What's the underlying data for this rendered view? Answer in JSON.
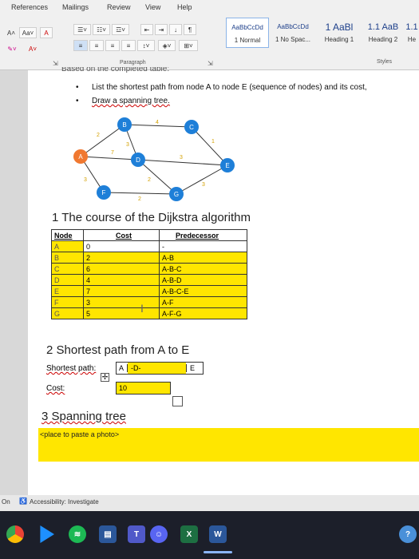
{
  "ribbon": {
    "tabs": [
      "References",
      "Mailings",
      "Review",
      "View",
      "Help"
    ],
    "paragraph_label": "Paragraph",
    "styles_label": "Styles",
    "styles": [
      {
        "preview": "AaBbCcDd",
        "name": "1 Normal"
      },
      {
        "preview": "AaBbCcDd",
        "name": "1 No Spac..."
      },
      {
        "preview": "1 AaBl",
        "name": "Heading 1"
      },
      {
        "preview": "1.1 AaB",
        "name": "Heading 2"
      },
      {
        "preview": "1.1",
        "name": "He"
      }
    ]
  },
  "doc": {
    "top_cut_text": "Based on the completed table:",
    "bullets": [
      "List the shortest path from node A to node E (sequence of nodes) and its cost,",
      "Draw a spanning tree."
    ],
    "section1": "1  The course of the Dijkstra algorithm",
    "table": {
      "headers": [
        "Node",
        "Cost",
        "Predecessor"
      ],
      "rows": [
        [
          "A",
          "0",
          "-"
        ],
        [
          "B",
          "2",
          "A-B"
        ],
        [
          "C",
          "6",
          "A-B-C"
        ],
        [
          "D",
          "4",
          "A-B-D"
        ],
        [
          "E",
          "7",
          "A-B-C-E"
        ],
        [
          "F",
          "3",
          "A-F"
        ],
        [
          "G",
          "5",
          "A-F-G"
        ]
      ]
    },
    "section2": "2  Shortest path from A to E",
    "path_label": "Shortest path:",
    "path_start": "A",
    "path_mid": "-D-",
    "path_end": "E",
    "cost_label": "Cost:",
    "cost_value": "10",
    "section3": "3  Spanning tree",
    "placeholder": "<place to paste a photo>"
  },
  "graph": {
    "nodes": [
      "A",
      "B",
      "C",
      "D",
      "E",
      "F",
      "G"
    ],
    "edge_weights": [
      "2",
      "4",
      "1",
      "7",
      "3",
      "3",
      "3",
      "2",
      "2",
      "3"
    ]
  },
  "status": {
    "left": "On",
    "accessibility": "Accessibility: Investigate"
  },
  "taskbar": {
    "word_letter": "W",
    "excel_letter": "X",
    "help": "?"
  }
}
